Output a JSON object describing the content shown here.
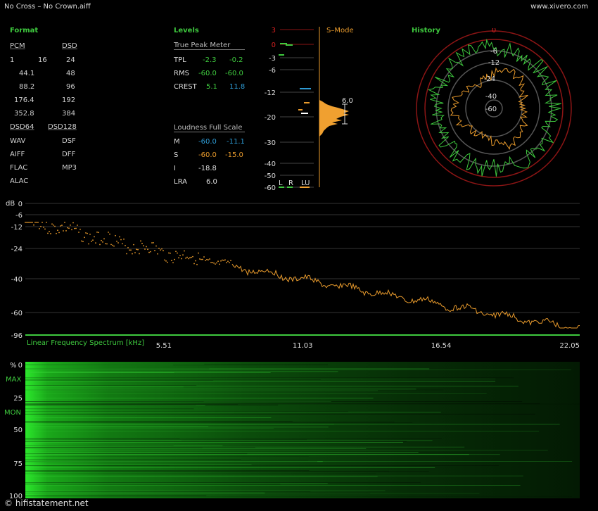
{
  "window": {
    "title": "No Cross – No Crown.aiff",
    "url": "www.xivero.com"
  },
  "format": {
    "heading": "Format",
    "pcm": "PCM",
    "dsd": "DSD",
    "bits": [
      "1",
      "16",
      "24"
    ],
    "rates_pcm": [
      "44.1",
      "88.2",
      "176.4",
      "352.8"
    ],
    "rates_dsd": [
      "48",
      "96",
      "192",
      "384"
    ],
    "dsd64": "DSD64",
    "dsd128": "DSD128",
    "files": [
      [
        "WAV",
        "DSF"
      ],
      [
        "AIFF",
        "DFF"
      ],
      [
        "FLAC",
        "MP3"
      ],
      [
        "ALAC",
        ""
      ]
    ]
  },
  "levels": {
    "heading": "Levels",
    "tpm_title": "True Peak Meter",
    "rows": [
      {
        "label": "TPL",
        "l": "-2.3",
        "r": "-0.2"
      },
      {
        "label": "RMS",
        "l": "-60.0",
        "r": "-60.0"
      },
      {
        "label": "CREST",
        "l": "5.1",
        "r": "11.8"
      }
    ],
    "lfs_title": "Loudness Full Scale",
    "lrows": [
      {
        "label": "M",
        "a": "-60.0",
        "b": "-11.1"
      },
      {
        "label": "S",
        "a": "-60.0",
        "b": "-15.0"
      },
      {
        "label": "I",
        "a": "-18.8",
        "b": ""
      },
      {
        "label": "LRA",
        "a": "6.0",
        "b": ""
      }
    ]
  },
  "meter": {
    "smode": "S–Mode",
    "scale": [
      "3",
      "0",
      "-3",
      "-6",
      "-12",
      "-20",
      "-30",
      "-40",
      "-50",
      "-60"
    ],
    "scale_values": [
      3,
      0,
      -3,
      -6,
      -12,
      -20,
      -30,
      -40,
      -50,
      -60
    ],
    "lra_value": "6.0",
    "channels": [
      "L",
      "R",
      "LU"
    ],
    "colors": {
      "red": "#d62020",
      "green": "#3ec93e",
      "blue": "#2e9bd4",
      "orange": "#f0a030"
    }
  },
  "history": {
    "heading": "History",
    "scale": [
      "0",
      "-6",
      "-12",
      "-24",
      "-40",
      "-60"
    ]
  },
  "spectrum": {
    "db_label": "dB",
    "y_ticks": [
      "0",
      "-6",
      "-12",
      "-24",
      "-40",
      "-60",
      "-96"
    ],
    "y_values": [
      0,
      -6,
      -12,
      -24,
      -40,
      -60,
      -96
    ],
    "x_ticks": [
      "5.51",
      "11.03",
      "16.54",
      "22.05"
    ],
    "x_values": [
      5.51,
      11.03,
      16.54,
      22.05
    ],
    "caption": "Linear Frequency Spectrum [kHz]"
  },
  "spectrogram": {
    "pct": "%",
    "ticks": [
      "0",
      "25",
      "50",
      "75",
      "100"
    ],
    "max_label": "MAX",
    "mon_label": "MON"
  },
  "watermark": "© hifistatement.net"
}
